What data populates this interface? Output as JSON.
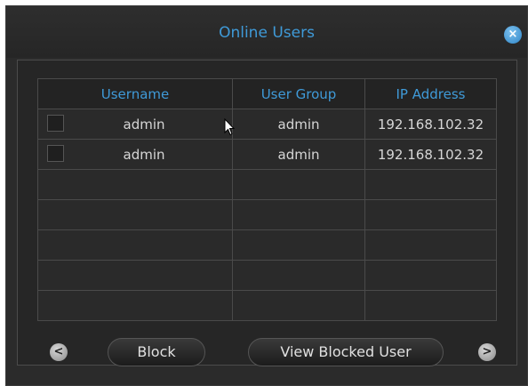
{
  "dialog": {
    "title": "Online Users",
    "close_icon": "close-icon",
    "close_label": "×"
  },
  "table": {
    "columns": [
      "Username",
      "User Group",
      "IP Address"
    ],
    "rows": [
      {
        "username": "admin",
        "user_group": "admin",
        "ip": "192.168.102.32",
        "checked": false
      },
      {
        "username": "admin",
        "user_group": "admin",
        "ip": "192.168.102.32",
        "checked": false
      }
    ],
    "empty_rows": 5
  },
  "footer": {
    "prev_icon": "chevron-left-icon",
    "prev_label": "<",
    "block_label": "Block",
    "view_blocked_label": "View Blocked User",
    "next_icon": "chevron-right-icon",
    "next_label": ">"
  },
  "colors": {
    "accent": "#3f9ad8",
    "background": "#2b2b2b",
    "text": "#d6d6d6"
  },
  "cursor_icon": "mouse-pointer-icon"
}
